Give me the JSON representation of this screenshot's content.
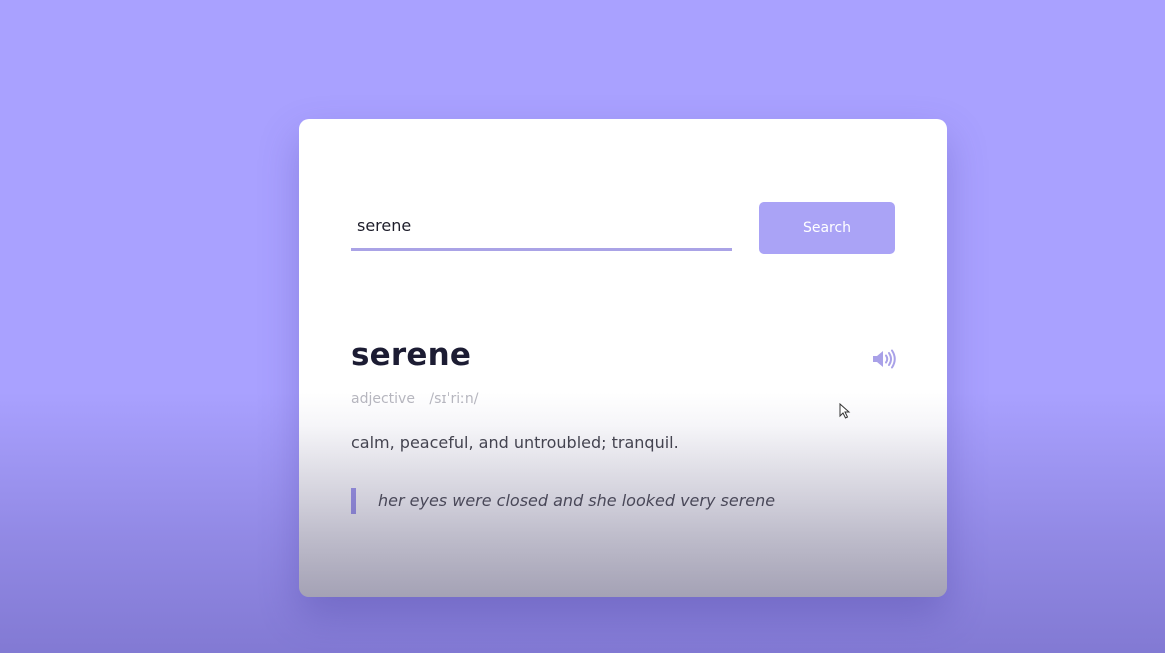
{
  "search": {
    "value": "serene",
    "button_label": "Search"
  },
  "entry": {
    "word": "serene",
    "part_of_speech": "adjective",
    "phonetic": "/sɪˈriːn/",
    "definition": "calm, peaceful, and untroubled; tranquil.",
    "example": "her eyes were closed and she looked very serene"
  },
  "icons": {
    "audio": "speaker-icon",
    "cursor": "mouse-pointer-icon"
  },
  "colors": {
    "background": "#a9a1ff",
    "accent": "#aaa3f6",
    "word": "#1c1c33",
    "muted": "#b7b7bf"
  }
}
